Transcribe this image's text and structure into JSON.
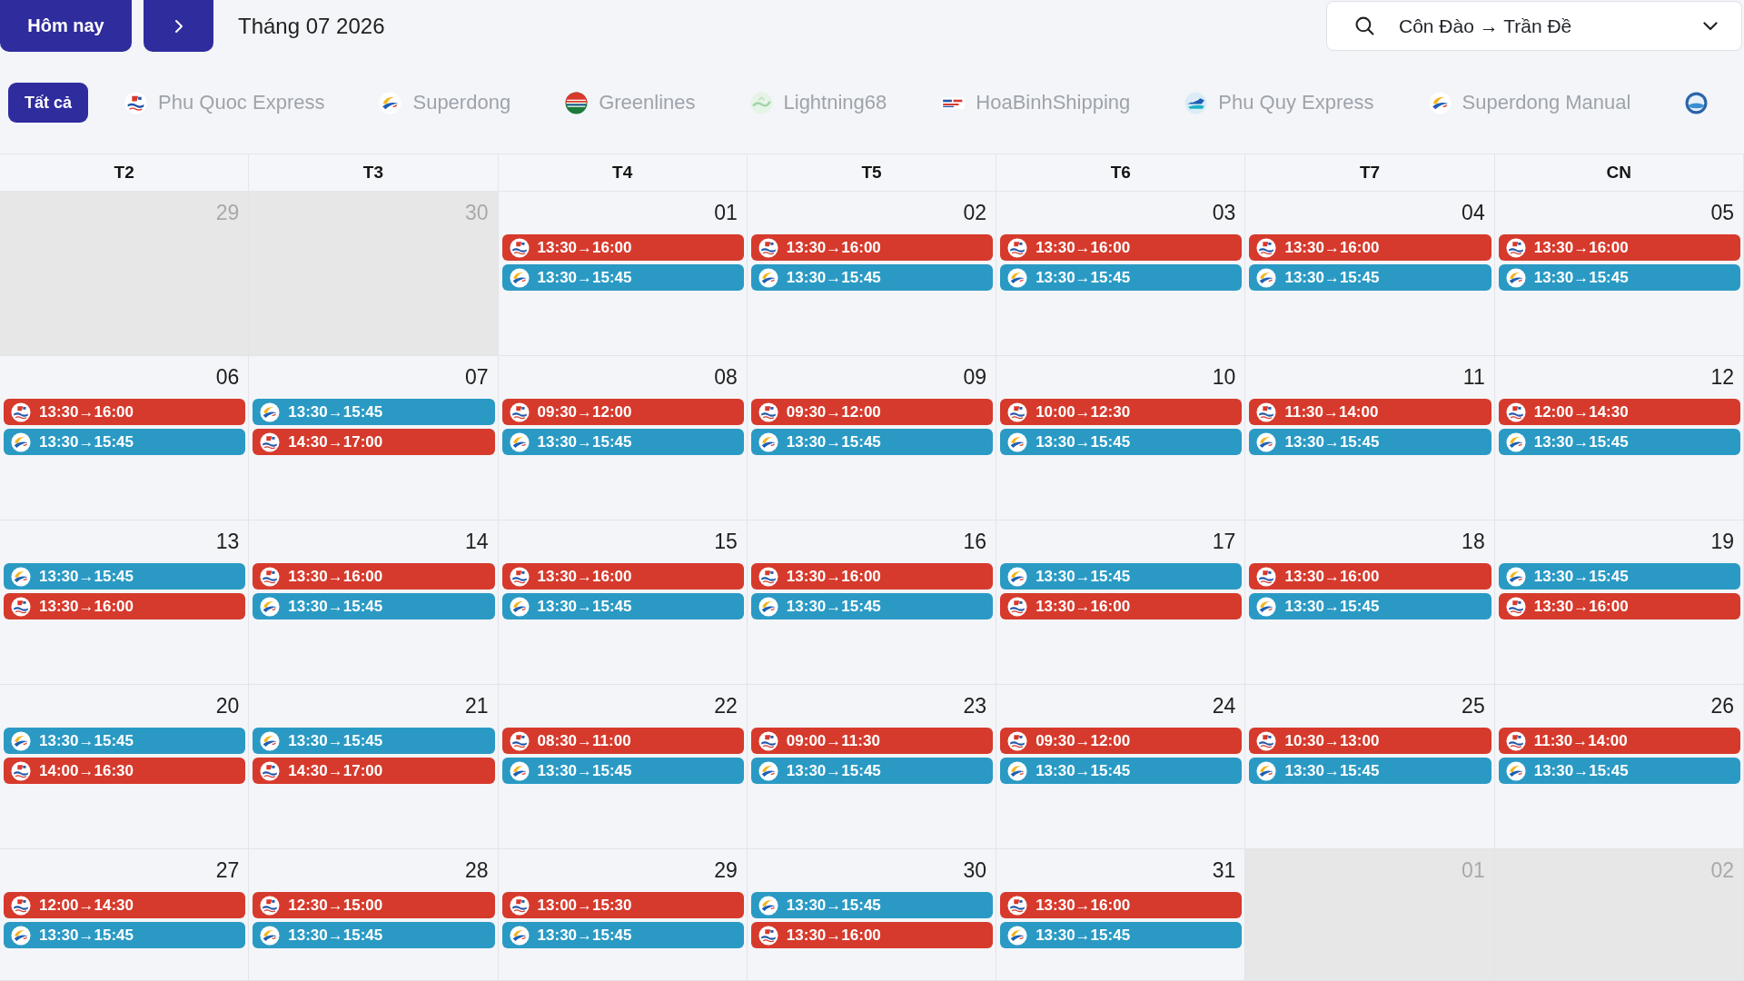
{
  "toolbar": {
    "today_button": "Hôm nay",
    "month_title": "Tháng 07 2026",
    "route_select": {
      "value": "Côn Đào → Trần Đề"
    }
  },
  "filters": [
    {
      "label": "Tất cả",
      "kind": "all",
      "selected": true
    },
    {
      "label": "Phu Quoc Express",
      "kind": "phuquoc",
      "selected": false
    },
    {
      "label": "Superdong",
      "kind": "superdong",
      "selected": false
    },
    {
      "label": "Greenlines",
      "kind": "greenlines",
      "selected": false
    },
    {
      "label": "Lightning68",
      "kind": "lightning",
      "selected": false
    },
    {
      "label": "HoaBinhShipping",
      "kind": "hoabinh",
      "selected": false
    },
    {
      "label": "Phu Quy Express",
      "kind": "phuquy",
      "selected": false
    },
    {
      "label": "Superdong Manual",
      "kind": "superdong",
      "selected": false
    },
    {
      "kind": "globe",
      "selected": false
    }
  ],
  "calendar": {
    "weekdays": [
      "T2",
      "T3",
      "T4",
      "T5",
      "T6",
      "T7",
      "CN"
    ],
    "weeks": [
      {
        "days": [
          {
            "day": "29",
            "other_month": true
          },
          {
            "day": "30",
            "other_month": true
          },
          {
            "day": "01",
            "other_month": false,
            "events": [
              {
                "time": "13:30→16:00",
                "kind": "phuquoc",
                "color": "#d63a2c"
              },
              {
                "time": "13:30→15:45",
                "kind": "superdong",
                "color": "#2a9ac4"
              }
            ]
          },
          {
            "day": "02",
            "other_month": false,
            "events": [
              {
                "time": "13:30→16:00",
                "kind": "phuquoc",
                "color": "#d63a2c"
              },
              {
                "time": "13:30→15:45",
                "kind": "superdong",
                "color": "#2a9ac4"
              }
            ]
          },
          {
            "day": "03",
            "other_month": false,
            "events": [
              {
                "time": "13:30→16:00",
                "kind": "phuquoc",
                "color": "#d63a2c"
              },
              {
                "time": "13:30→15:45",
                "kind": "superdong",
                "color": "#2a9ac4"
              }
            ]
          },
          {
            "day": "04",
            "other_month": false,
            "events": [
              {
                "time": "13:30→16:00",
                "kind": "phuquoc",
                "color": "#d63a2c"
              },
              {
                "time": "13:30→15:45",
                "kind": "superdong",
                "color": "#2a9ac4"
              }
            ]
          },
          {
            "day": "05",
            "other_month": false,
            "events": [
              {
                "time": "13:30→16:00",
                "kind": "phuquoc",
                "color": "#d63a2c"
              },
              {
                "time": "13:30→15:45",
                "kind": "superdong",
                "color": "#2a9ac4"
              }
            ]
          }
        ]
      },
      {
        "days": [
          {
            "day": "06",
            "other_month": false,
            "events": [
              {
                "time": "13:30→16:00",
                "kind": "phuquoc",
                "color": "#d63a2c"
              },
              {
                "time": "13:30→15:45",
                "kind": "superdong",
                "color": "#2a9ac4"
              }
            ]
          },
          {
            "day": "07",
            "other_month": false,
            "events": [
              {
                "time": "13:30→15:45",
                "kind": "superdong",
                "color": "#2a9ac4"
              },
              {
                "time": "14:30→17:00",
                "kind": "phuquoc",
                "color": "#d63a2c"
              }
            ]
          },
          {
            "day": "08",
            "other_month": false,
            "events": [
              {
                "time": "09:30→12:00",
                "kind": "phuquoc",
                "color": "#d63a2c"
              },
              {
                "time": "13:30→15:45",
                "kind": "superdong",
                "color": "#2a9ac4"
              }
            ]
          },
          {
            "day": "09",
            "other_month": false,
            "events": [
              {
                "time": "09:30→12:00",
                "kind": "phuquoc",
                "color": "#d63a2c"
              },
              {
                "time": "13:30→15:45",
                "kind": "superdong",
                "color": "#2a9ac4"
              }
            ]
          },
          {
            "day": "10",
            "other_month": false,
            "events": [
              {
                "time": "10:00→12:30",
                "kind": "phuquoc",
                "color": "#d63a2c"
              },
              {
                "time": "13:30→15:45",
                "kind": "superdong",
                "color": "#2a9ac4"
              }
            ]
          },
          {
            "day": "11",
            "other_month": false,
            "events": [
              {
                "time": "11:30→14:00",
                "kind": "phuquoc",
                "color": "#d63a2c"
              },
              {
                "time": "13:30→15:45",
                "kind": "superdong",
                "color": "#2a9ac4"
              }
            ]
          },
          {
            "day": "12",
            "other_month": false,
            "events": [
              {
                "time": "12:00→14:30",
                "kind": "phuquoc",
                "color": "#d63a2c"
              },
              {
                "time": "13:30→15:45",
                "kind": "superdong",
                "color": "#2a9ac4"
              }
            ]
          }
        ]
      },
      {
        "days": [
          {
            "day": "13",
            "other_month": false,
            "events": [
              {
                "time": "13:30→15:45",
                "kind": "superdong",
                "color": "#2a9ac4"
              },
              {
                "time": "13:30→16:00",
                "kind": "phuquoc",
                "color": "#d63a2c"
              }
            ]
          },
          {
            "day": "14",
            "other_month": false,
            "events": [
              {
                "time": "13:30→16:00",
                "kind": "phuquoc",
                "color": "#d63a2c"
              },
              {
                "time": "13:30→15:45",
                "kind": "superdong",
                "color": "#2a9ac4"
              }
            ]
          },
          {
            "day": "15",
            "other_month": false,
            "events": [
              {
                "time": "13:30→16:00",
                "kind": "phuquoc",
                "color": "#d63a2c"
              },
              {
                "time": "13:30→15:45",
                "kind": "superdong",
                "color": "#2a9ac4"
              }
            ]
          },
          {
            "day": "16",
            "other_month": false,
            "events": [
              {
                "time": "13:30→16:00",
                "kind": "phuquoc",
                "color": "#d63a2c"
              },
              {
                "time": "13:30→15:45",
                "kind": "superdong",
                "color": "#2a9ac4"
              }
            ]
          },
          {
            "day": "17",
            "other_month": false,
            "events": [
              {
                "time": "13:30→15:45",
                "kind": "superdong",
                "color": "#2a9ac4"
              },
              {
                "time": "13:30→16:00",
                "kind": "phuquoc",
                "color": "#d63a2c"
              }
            ]
          },
          {
            "day": "18",
            "other_month": false,
            "events": [
              {
                "time": "13:30→16:00",
                "kind": "phuquoc",
                "color": "#d63a2c"
              },
              {
                "time": "13:30→15:45",
                "kind": "superdong",
                "color": "#2a9ac4"
              }
            ]
          },
          {
            "day": "19",
            "other_month": false,
            "events": [
              {
                "time": "13:30→15:45",
                "kind": "superdong",
                "color": "#2a9ac4"
              },
              {
                "time": "13:30→16:00",
                "kind": "phuquoc",
                "color": "#d63a2c"
              }
            ]
          }
        ]
      },
      {
        "days": [
          {
            "day": "20",
            "other_month": false,
            "events": [
              {
                "time": "13:30→15:45",
                "kind": "superdong",
                "color": "#2a9ac4"
              },
              {
                "time": "14:00→16:30",
                "kind": "phuquoc",
                "color": "#d63a2c"
              }
            ]
          },
          {
            "day": "21",
            "other_month": false,
            "events": [
              {
                "time": "13:30→15:45",
                "kind": "superdong",
                "color": "#2a9ac4"
              },
              {
                "time": "14:30→17:00",
                "kind": "phuquoc",
                "color": "#d63a2c"
              }
            ]
          },
          {
            "day": "22",
            "other_month": false,
            "events": [
              {
                "time": "08:30→11:00",
                "kind": "phuquoc",
                "color": "#d63a2c"
              },
              {
                "time": "13:30→15:45",
                "kind": "superdong",
                "color": "#2a9ac4"
              }
            ]
          },
          {
            "day": "23",
            "other_month": false,
            "events": [
              {
                "time": "09:00→11:30",
                "kind": "phuquoc",
                "color": "#d63a2c"
              },
              {
                "time": "13:30→15:45",
                "kind": "superdong",
                "color": "#2a9ac4"
              }
            ]
          },
          {
            "day": "24",
            "other_month": false,
            "events": [
              {
                "time": "09:30→12:00",
                "kind": "phuquoc",
                "color": "#d63a2c"
              },
              {
                "time": "13:30→15:45",
                "kind": "superdong",
                "color": "#2a9ac4"
              }
            ]
          },
          {
            "day": "25",
            "other_month": false,
            "events": [
              {
                "time": "10:30→13:00",
                "kind": "phuquoc",
                "color": "#d63a2c"
              },
              {
                "time": "13:30→15:45",
                "kind": "superdong",
                "color": "#2a9ac4"
              }
            ]
          },
          {
            "day": "26",
            "other_month": false,
            "events": [
              {
                "time": "11:30→14:00",
                "kind": "phuquoc",
                "color": "#d63a2c"
              },
              {
                "time": "13:30→15:45",
                "kind": "superdong",
                "color": "#2a9ac4"
              }
            ]
          }
        ]
      },
      {
        "days": [
          {
            "day": "27",
            "other_month": false,
            "events": [
              {
                "time": "12:00→14:30",
                "kind": "phuquoc",
                "color": "#d63a2c"
              },
              {
                "time": "13:30→15:45",
                "kind": "superdong",
                "color": "#2a9ac4"
              }
            ]
          },
          {
            "day": "28",
            "other_month": false,
            "events": [
              {
                "time": "12:30→15:00",
                "kind": "phuquoc",
                "color": "#d63a2c"
              },
              {
                "time": "13:30→15:45",
                "kind": "superdong",
                "color": "#2a9ac4"
              }
            ]
          },
          {
            "day": "29",
            "other_month": false,
            "events": [
              {
                "time": "13:00→15:30",
                "kind": "phuquoc",
                "color": "#d63a2c"
              },
              {
                "time": "13:30→15:45",
                "kind": "superdong",
                "color": "#2a9ac4"
              }
            ]
          },
          {
            "day": "30",
            "other_month": false,
            "events": [
              {
                "time": "13:30→15:45",
                "kind": "superdong",
                "color": "#2a9ac4"
              },
              {
                "time": "13:30→16:00",
                "kind": "phuquoc",
                "color": "#d63a2c"
              }
            ]
          },
          {
            "day": "31",
            "other_month": false,
            "events": [
              {
                "time": "13:30→16:00",
                "kind": "phuquoc",
                "color": "#d63a2c"
              },
              {
                "time": "13:30→15:45",
                "kind": "superdong",
                "color": "#2a9ac4"
              }
            ]
          },
          {
            "day": "01",
            "other_month": true
          },
          {
            "day": "02",
            "other_month": true
          }
        ]
      }
    ]
  }
}
